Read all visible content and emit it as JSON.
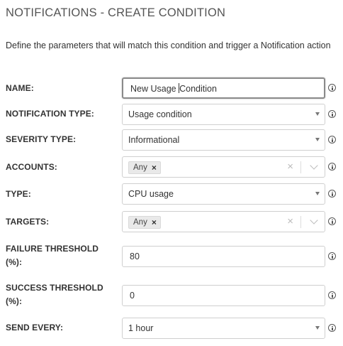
{
  "page": {
    "title": "NOTIFICATIONS - CREATE CONDITION",
    "description": "Define the parameters that will match this condition and trigger a Notification action"
  },
  "form": {
    "name": {
      "label": "NAME:",
      "value": "New Usage Condition"
    },
    "notification_type": {
      "label": "NOTIFICATION TYPE:",
      "value": "Usage condition"
    },
    "severity_type": {
      "label": "SEVERITY TYPE:",
      "value": "Informational"
    },
    "accounts": {
      "label": "ACCOUNTS:",
      "chip": "Any"
    },
    "type": {
      "label": "TYPE:",
      "value": "CPU usage"
    },
    "targets": {
      "label": "TARGETS:",
      "chip": "Any"
    },
    "failure_threshold": {
      "label_line1": "FAILURE THRESHOLD",
      "label_line2": "(%):",
      "value": "80"
    },
    "success_threshold": {
      "label_line1": "SUCCESS THRESHOLD",
      "label_line2": "(%):",
      "value": "0"
    },
    "send_every": {
      "label": "SEND EVERY:",
      "value": "1 hour"
    }
  },
  "icons": {
    "info": "info-circle-icon",
    "dropdown": "caret-down-icon",
    "clear": "clear-x-icon",
    "chevron": "chevron-down-icon",
    "chip_remove": "chip-remove-icon"
  }
}
